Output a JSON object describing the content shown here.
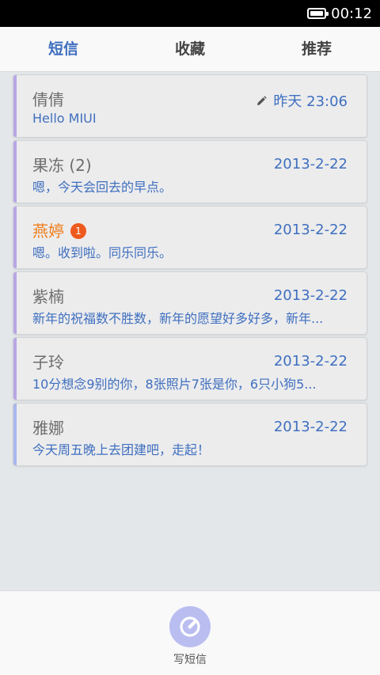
{
  "status_bar": {
    "time": "00:12",
    "battery_icon": "battery-full-icon"
  },
  "tabs": [
    {
      "label": "短信",
      "active": true
    },
    {
      "label": "收藏",
      "active": false
    },
    {
      "label": "推荐",
      "active": false
    }
  ],
  "messages": [
    {
      "sender": "倩倩",
      "date": "昨天 23:06",
      "preview": "Hello MIUI",
      "draft": true
    },
    {
      "sender": "果冻 (2)",
      "date": "2013-2-22",
      "preview": "嗯，今天会回去的早点。"
    },
    {
      "sender": "燕婷",
      "date": "2013-2-22",
      "preview": "嗯。收到啦。同乐同乐。",
      "unread_count": "1"
    },
    {
      "sender": "紫楠",
      "date": "2013-2-22",
      "preview": "新年的祝福数不胜数，新年的愿望好多好多，新年..."
    },
    {
      "sender": "子玲",
      "date": "2013-2-22",
      "preview": "10分想念9别的你，8张照片7张是你，6只小狗5..."
    },
    {
      "sender": "雅娜",
      "date": "2013-2-22",
      "preview": "今天周五晚上去团建吧，走起！"
    }
  ],
  "compose": {
    "label": "写短信",
    "icon": "compose-icon"
  },
  "colors": {
    "accent": "#3f6fbf",
    "unread": "#ef7d1a",
    "badge": "#ee5a1e",
    "card_bar": "#b8a6e6",
    "card_bar_last": "#a8b6ee",
    "compose_button": "#b9bdf0"
  }
}
